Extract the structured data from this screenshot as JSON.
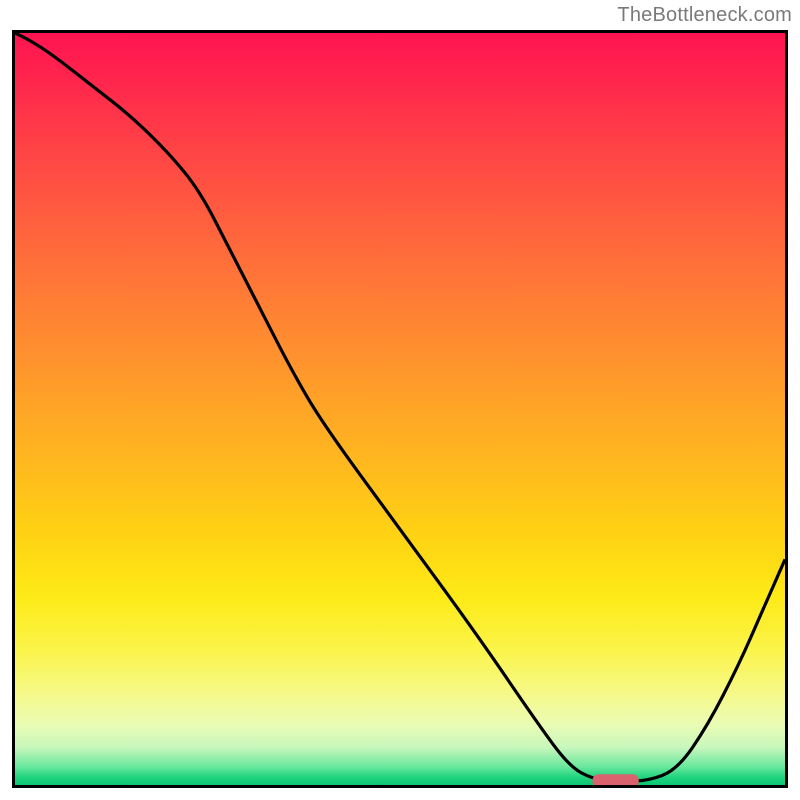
{
  "attribution": "TheBottleneck.com",
  "accent": {
    "marker_fill": "#d9626e"
  },
  "chart_data": {
    "type": "line",
    "title": "",
    "xlabel": "",
    "ylabel": "",
    "xlim": [
      0,
      100
    ],
    "ylim": [
      0,
      100
    ],
    "x": [
      0,
      2,
      5,
      10,
      15,
      20,
      24,
      28,
      32,
      36,
      40,
      50,
      60,
      68,
      72,
      75,
      78,
      82,
      86,
      90,
      94,
      97,
      100
    ],
    "values": [
      100,
      99,
      97,
      93,
      89,
      84,
      79,
      71,
      63,
      55,
      48,
      34,
      20,
      8,
      2.5,
      0.8,
      0.5,
      0.5,
      2,
      8,
      16,
      23,
      30
    ],
    "optimum_marker": {
      "x": 78,
      "width": 6,
      "y": 0.5
    },
    "note": "x and y are in percent of the inner plotting box; (0,0) is the bottom-left corner of the black-bordered square. Values were read off the curve relative to the dense rainbow gradient; the chart shows no numeric axes or tick labels."
  }
}
